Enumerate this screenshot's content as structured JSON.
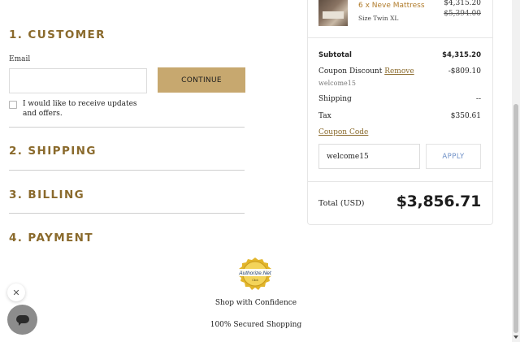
{
  "sections": {
    "customer": "1. CUSTOMER",
    "shipping": "2. SHIPPING",
    "billing": "3. BILLING",
    "payment": "4. PAYMENT"
  },
  "customer": {
    "email_label": "Email",
    "email_value": "",
    "continue_label": "CONTINUE",
    "updates_label": "I would like to receive updates and offers.",
    "updates_checked": false
  },
  "summary": {
    "product": {
      "name": "6 x Neve Mattress",
      "size": "Size Twin XL",
      "price": "$4,315.20",
      "original_price": "$5,394.00",
      "image": "bedroom-photo-thumbnail"
    },
    "subtotal_label": "Subtotal",
    "subtotal_value": "$4,315.20",
    "coupon_label": "Coupon Discount",
    "coupon_remove": "Remove",
    "coupon_code_applied": "welcome15",
    "coupon_value": "-$809.10",
    "shipping_label": "Shipping",
    "shipping_value": "--",
    "tax_label": "Tax",
    "tax_value": "$350.61",
    "coupon_code_link": "Coupon Code",
    "coupon_input_value": "welcome15",
    "apply_label": "APPLY",
    "total_label": "Total (USD)",
    "total_value": "$3,856.71"
  },
  "footer": {
    "badge_line1": "Authorize.Net",
    "badge_line2": "Click",
    "confidence": "Shop with Confidence",
    "secured": "100% Secured Shopping"
  },
  "chat": {
    "close_icon": "close-icon",
    "launcher_icon": "chat-bubble-icon"
  },
  "colors": {
    "accent_gold": "#8a6a2c",
    "button_gold": "#c7a86f",
    "product_orange": "#b07b2a",
    "apply_blue": "#6d8fc6"
  }
}
